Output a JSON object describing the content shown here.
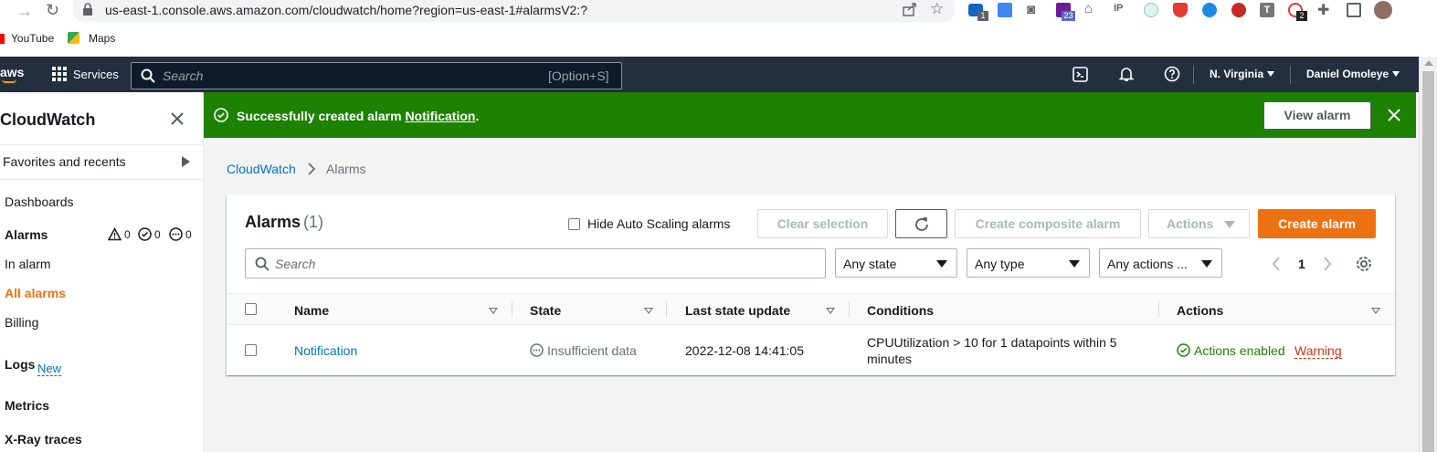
{
  "browser": {
    "url": "us-east-1.console.aws.amazon.com/cloudwatch/home?region=us-east-1#alarmsV2:?",
    "bookmarks": [
      "YouTube",
      "Maps"
    ],
    "ext_badge_1": "1",
    "ext_badge_23": "23",
    "ext_badge_2": "2"
  },
  "topnav": {
    "logo": "aws",
    "services_label": "Services",
    "search_placeholder": "Search",
    "search_shortcut": "[Option+S]",
    "region": "N. Virginia",
    "user": "Daniel Omoleye"
  },
  "sidebar": {
    "title": "CloudWatch",
    "favorites": "Favorites and recents",
    "dashboards": "Dashboards",
    "alarms": "Alarms",
    "alarm_counts": {
      "in_alarm": "0",
      "ok": "0",
      "insufficient": "0"
    },
    "in_alarm": "In alarm",
    "all_alarms": "All alarms",
    "billing": "Billing",
    "logs": "Logs",
    "logs_badge": "New",
    "metrics": "Metrics",
    "xray": "X-Ray traces"
  },
  "flash": {
    "prefix": "Successfully created alarm",
    "alarm_name": "Notification",
    "suffix": ".",
    "view_button": "View alarm"
  },
  "breadcrumb": {
    "root": "CloudWatch",
    "current": "Alarms"
  },
  "panel": {
    "title": "Alarms",
    "count": "(1)",
    "hide_autoscaling": "Hide Auto Scaling alarms",
    "clear_selection": "Clear selection",
    "create_composite": "Create composite alarm",
    "actions": "Actions",
    "create_alarm": "Create alarm",
    "search_placeholder": "Search",
    "filter_state": "Any state",
    "filter_type": "Any type",
    "filter_actions": "Any actions ...",
    "page": "1"
  },
  "table": {
    "headers": [
      "Name",
      "State",
      "Last state update",
      "Conditions",
      "Actions"
    ],
    "rows": [
      {
        "name": "Notification",
        "state": "Insufficient data",
        "last_update": "2022-12-08 14:41:05",
        "conditions_line1": "CPUUtilization > 10 for 1 datapoints within 5",
        "conditions_line2": "minutes",
        "actions_status": "Actions enabled",
        "actions_warning": "Warning"
      }
    ]
  },
  "colors": {
    "aws_nav": "#232f3e",
    "success": "#1d8102",
    "primary": "#ec7211",
    "link": "#0073bb",
    "orange_active": "#ec7211"
  }
}
